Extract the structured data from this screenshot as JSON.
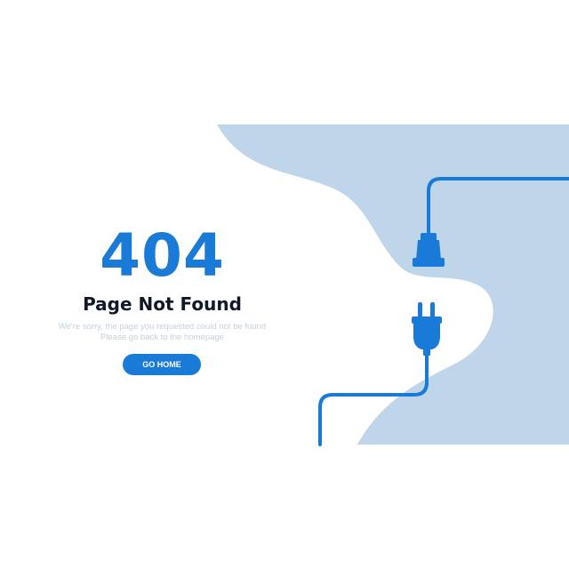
{
  "error": {
    "code": "404",
    "title": "Page Not Found",
    "message_line1": "We're sorry, the page you requested could not be found",
    "message_line2": "Please go back to the homepage"
  },
  "actions": {
    "go_home_label": "GO HOME"
  },
  "illustration": {
    "background_icon": "blob-shape",
    "socket_icon": "power-socket-icon",
    "plug_icon": "power-plug-icon",
    "cable_icon": "cable-icon"
  },
  "colors": {
    "accent": "#1a7ad8",
    "blob": "#bfd6ea",
    "title": "#111827",
    "message": "#c3d0df",
    "background": "#ffffff"
  }
}
